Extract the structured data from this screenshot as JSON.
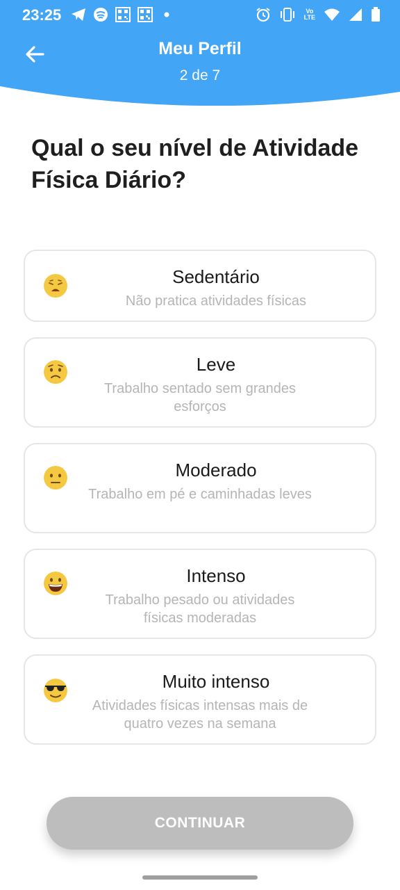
{
  "status_bar": {
    "time": "23:25",
    "lte_top": "Vo",
    "lte_bottom": "LTE",
    "icons": [
      "telegram-icon",
      "app-icon",
      "qr-icon",
      "qr-icon",
      "dot-icon",
      "alarm-icon",
      "vibrate-icon",
      "volte-icon",
      "wifi-icon",
      "signal-icon",
      "battery-icon"
    ]
  },
  "header": {
    "title": "Meu Perfil",
    "step": "2 de 7",
    "back_icon": "arrow-left-icon",
    "color": "#42A5F5"
  },
  "question": "Qual o seu nível de Atividade Física Diário?",
  "options": [
    {
      "label": "Sedentário",
      "description": "Não pratica atividades físicas",
      "icon": "tired-face-emoji-icon"
    },
    {
      "label": "Leve",
      "description": "Trabalho sentado sem grandes esforços",
      "icon": "worried-face-emoji-icon"
    },
    {
      "label": "Moderado",
      "description": "Trabalho em pé e caminhadas leves",
      "icon": "neutral-face-emoji-icon"
    },
    {
      "label": "Intenso",
      "description": "Trabalho pesado ou atividades físicas moderadas",
      "icon": "grinning-face-emoji-icon"
    },
    {
      "label": "Muito intenso",
      "description": "Atividades físicas intensas mais de quatro vezes na semana",
      "icon": "sunglasses-face-emoji-icon"
    }
  ],
  "continue_label": "CONTINUAR",
  "colors": {
    "accent": "#42A5F5",
    "button_disabled": "#BDBDBD",
    "emoji": "#F5C842"
  }
}
